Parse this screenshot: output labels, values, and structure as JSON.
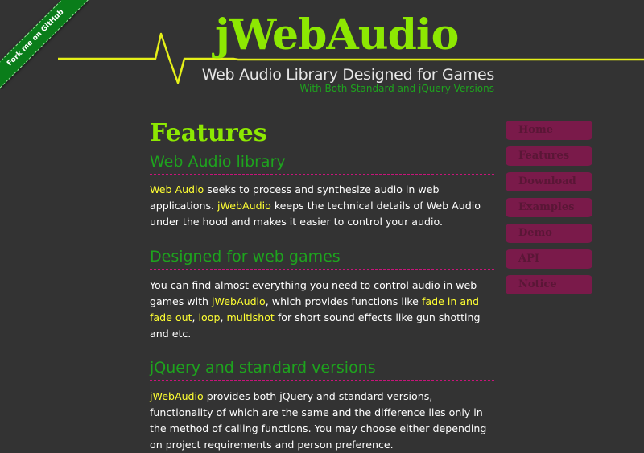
{
  "fork_ribbon": {
    "label": "Fork me on GitHub"
  },
  "header": {
    "logo": "jWebAudio",
    "tagline": "Web Audio Library Designed for Games",
    "subtagline": "With Both Standard and jQuery Versions"
  },
  "main": {
    "title": "Features",
    "sections": [
      {
        "heading": "Web Audio library",
        "parts": [
          {
            "text": "Web Audio",
            "highlight": true
          },
          {
            "text": " seeks to process and synthesize audio in web applications. ",
            "highlight": false
          },
          {
            "text": "jWebAudio",
            "highlight": true
          },
          {
            "text": " keeps the technical details of Web Audio under the hood and makes it easier to control your audio.",
            "highlight": false
          }
        ]
      },
      {
        "heading": "Designed for web games",
        "parts": [
          {
            "text": "You can find almost everything you need to control audio in web games with ",
            "highlight": false
          },
          {
            "text": "jWebAudio",
            "highlight": true
          },
          {
            "text": ", which provides functions like ",
            "highlight": false
          },
          {
            "text": "fade in and fade out",
            "highlight": true
          },
          {
            "text": ", ",
            "highlight": false
          },
          {
            "text": "loop",
            "highlight": true
          },
          {
            "text": ", ",
            "highlight": false
          },
          {
            "text": "multishot",
            "highlight": true
          },
          {
            "text": " for short sound effects like gun shotting and etc.",
            "highlight": false
          }
        ]
      },
      {
        "heading": "jQuery and standard versions",
        "parts": [
          {
            "text": "jWebAudio",
            "highlight": true
          },
          {
            "text": " provides both jQuery and standard versions, functionality of which are the same and the difference lies only in the method of calling functions. You may choose either depending on project requirements and person preference.",
            "highlight": false
          }
        ]
      }
    ]
  },
  "nav": {
    "items": [
      "Home",
      "Features",
      "Download",
      "Examples",
      "Demo",
      "API",
      "Notice"
    ]
  },
  "colors": {
    "background": "#333333",
    "logo_green": "#8de802",
    "heading_green": "#1ea31e",
    "highlight_yellow": "#ffff33",
    "pulse_line": "#e5f018",
    "divider_magenta": "#c8147a",
    "nav_button": "#7a1a4a"
  }
}
